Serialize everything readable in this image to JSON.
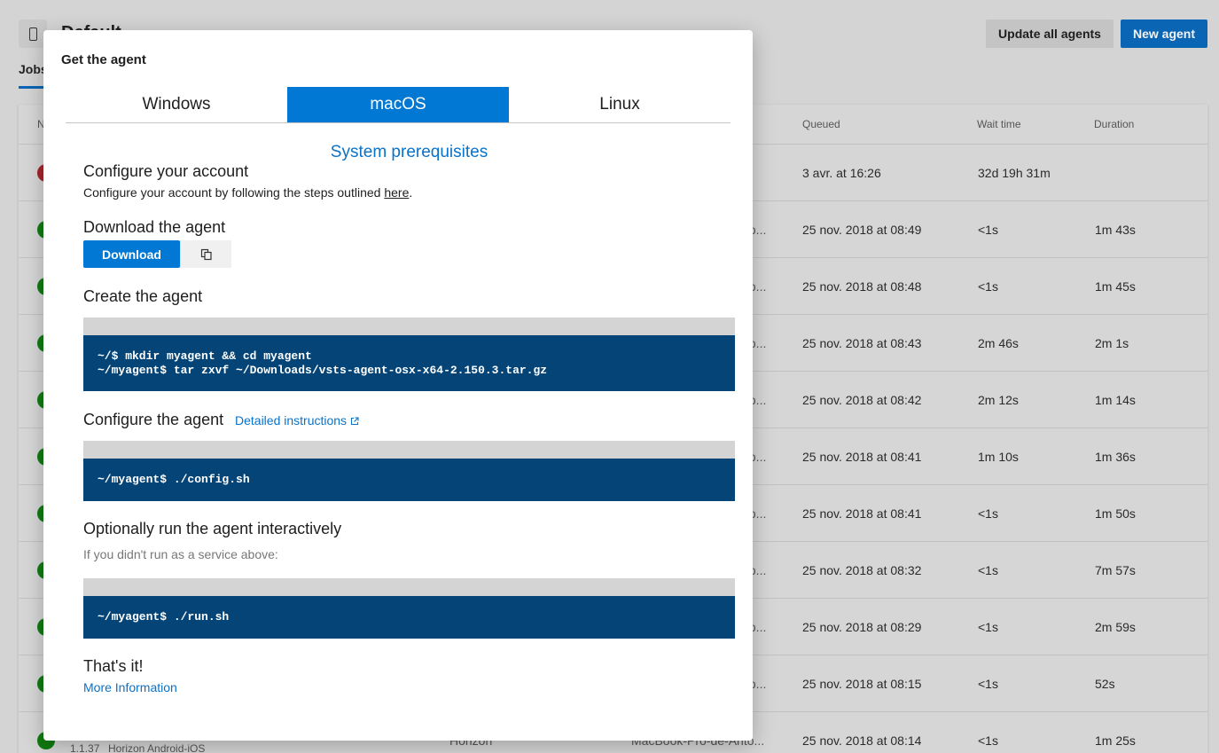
{
  "background": {
    "pool_title": "Default",
    "tab_jobs": "Jobs",
    "update_all_label": "Update all agents",
    "new_agent_label": "New agent",
    "columns": {
      "first": "N",
      "queued": "Queued",
      "wait": "Wait time",
      "duration": "Duration"
    },
    "rows": [
      {
        "status": "failed",
        "agent": "",
        "queued": "3 avr. at 16:26",
        "wait": "32d 19h 31m",
        "duration": ""
      },
      {
        "status": "success",
        "agent": "to...",
        "queued": "25 nov. 2018 at 08:49",
        "wait": "<1s",
        "duration": "1m 43s"
      },
      {
        "status": "success",
        "agent": "to...",
        "queued": "25 nov. 2018 at 08:48",
        "wait": "<1s",
        "duration": "1m 45s"
      },
      {
        "status": "success",
        "agent": "to...",
        "queued": "25 nov. 2018 at 08:43",
        "wait": "2m 46s",
        "duration": "2m 1s"
      },
      {
        "status": "success",
        "agent": "to...",
        "queued": "25 nov. 2018 at 08:42",
        "wait": "2m 12s",
        "duration": "1m 14s"
      },
      {
        "status": "success",
        "agent": "to...",
        "queued": "25 nov. 2018 at 08:41",
        "wait": "1m 10s",
        "duration": "1m 36s"
      },
      {
        "status": "success",
        "agent": "to...",
        "queued": "25 nov. 2018 at 08:41",
        "wait": "<1s",
        "duration": "1m 50s"
      },
      {
        "status": "success",
        "agent": "to...",
        "queued": "25 nov. 2018 at 08:32",
        "wait": "<1s",
        "duration": "7m 57s"
      },
      {
        "status": "success",
        "agent": "to...",
        "queued": "25 nov. 2018 at 08:29",
        "wait": "<1s",
        "duration": "2m 59s"
      },
      {
        "status": "success",
        "agent": "to...",
        "queued": "25 nov. 2018 at 08:15",
        "wait": "<1s",
        "duration": "52s"
      },
      {
        "status": "success",
        "agent": "",
        "queued": "25 nov. 2018 at 08:14",
        "wait": "<1s",
        "duration": "1m 25s",
        "build": "1.1.37",
        "definition": "Horizon Android-iOS",
        "requester": "Horizon",
        "agent_full": "MacBook-Pro-de-Anto..."
      }
    ],
    "status_colors": {
      "success": "#107c10",
      "failed": "#a4262c"
    }
  },
  "modal": {
    "title": "Get the agent",
    "tabs": [
      {
        "label": "Windows",
        "active": false
      },
      {
        "label": "macOS",
        "active": true
      },
      {
        "label": "Linux",
        "active": false
      }
    ],
    "prerequisites_link": "System prerequisites",
    "configure_account": {
      "heading": "Configure your account",
      "text_before": "Configure your account by following the steps outlined ",
      "link": "here",
      "text_after": "."
    },
    "download": {
      "heading": "Download the agent",
      "button_label": "Download",
      "copy_icon": "copy-icon"
    },
    "create": {
      "heading": "Create the agent",
      "code": [
        "~/$ mkdir myagent && cd myagent",
        "~/myagent$ tar zxvf ~/Downloads/vsts-agent-osx-x64-2.150.3.tar.gz"
      ]
    },
    "configure_agent": {
      "heading": "Configure the agent",
      "link": "Detailed instructions",
      "code": [
        "~/myagent$ ./config.sh"
      ]
    },
    "run": {
      "heading": "Optionally run the agent interactively",
      "note": "If you didn't run as a service above:",
      "code": [
        "~/myagent$ ./run.sh"
      ]
    },
    "done": {
      "heading": "That's it!",
      "link": "More Information"
    },
    "colors": {
      "accent": "#0078d4",
      "code_bg": "#044477",
      "code_bar": "#d4d4d4"
    }
  }
}
